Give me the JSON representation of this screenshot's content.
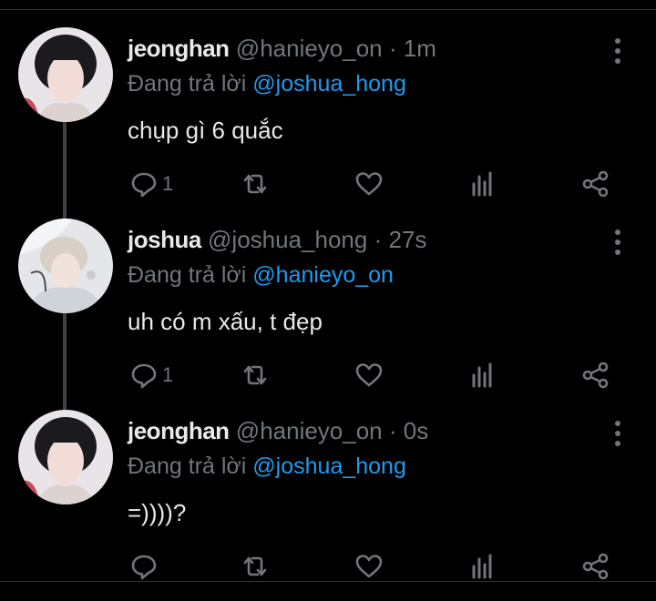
{
  "colors": {
    "background": "#000000",
    "text": "#e7e9ea",
    "muted": "#71767b",
    "link": "#1d9bf0",
    "thread": "#3e4144"
  },
  "reply_prefix": "Đang trả lời",
  "tweets": [
    {
      "name": "jeonghan",
      "handle": "@hanieyo_on",
      "separator": "·",
      "time": "1m",
      "reply_to": "@joshua_hong",
      "text": "chụp gì 6 quắc",
      "reply_count": "1"
    },
    {
      "name": "joshua",
      "handle": "@joshua_hong",
      "separator": "·",
      "time": "27s",
      "reply_to": "@hanieyo_on",
      "text": "uh có m xấu, t đẹp",
      "reply_count": "1"
    },
    {
      "name": "jeonghan",
      "handle": "@hanieyo_on",
      "separator": "·",
      "time": "0s",
      "reply_to": "@joshua_hong",
      "text": "=))))?",
      "reply_count": ""
    }
  ],
  "icons": [
    "reply-icon",
    "retweet-icon",
    "like-icon",
    "analytics-icon",
    "share-icon",
    "more-icon"
  ]
}
